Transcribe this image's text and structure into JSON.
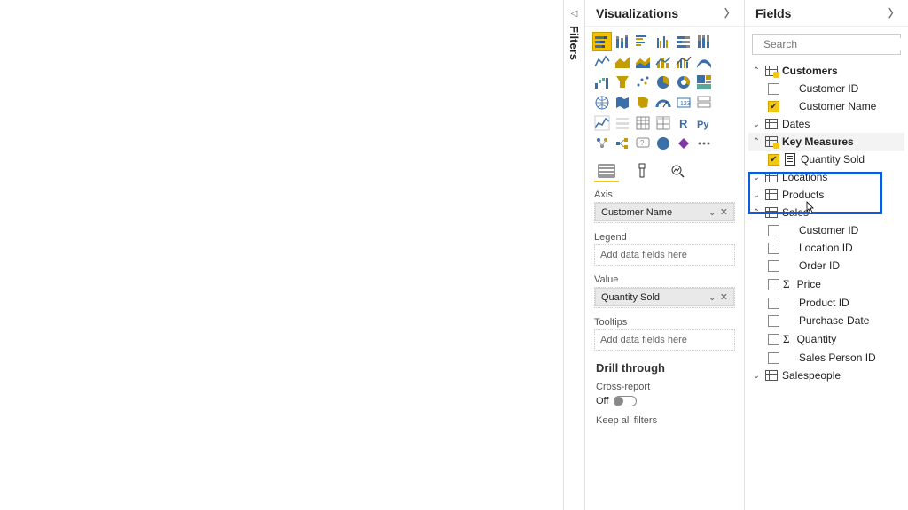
{
  "filters": {
    "label": "Filters"
  },
  "viz": {
    "title": "Visualizations",
    "wells": {
      "axis": {
        "label": "Axis",
        "item": "Customer Name"
      },
      "legend": {
        "label": "Legend",
        "placeholder": "Add data fields here"
      },
      "value": {
        "label": "Value",
        "item": "Quantity Sold"
      },
      "tooltips": {
        "label": "Tooltips",
        "placeholder": "Add data fields here"
      }
    },
    "drill": {
      "title": "Drill through",
      "cross": "Cross-report",
      "off": "Off",
      "keep": "Keep all filters"
    }
  },
  "fields": {
    "title": "Fields",
    "search_placeholder": "Search",
    "tables": {
      "customers": {
        "name": "Customers",
        "id": "Customer ID",
        "namef": "Customer Name"
      },
      "dates": {
        "name": "Dates"
      },
      "key": {
        "name": "Key Measures",
        "qty": "Quantity Sold"
      },
      "locations": {
        "name": "Locations"
      },
      "products": {
        "name": "Products"
      },
      "sales": {
        "name": "Sales",
        "cid": "Customer ID",
        "lid": "Location ID",
        "oid": "Order ID",
        "price": "Price",
        "pid": "Product ID",
        "pdate": "Purchase Date",
        "qty": "Quantity",
        "spid": "Sales Person ID"
      },
      "salespeople": {
        "name": "Salespeople"
      }
    }
  }
}
